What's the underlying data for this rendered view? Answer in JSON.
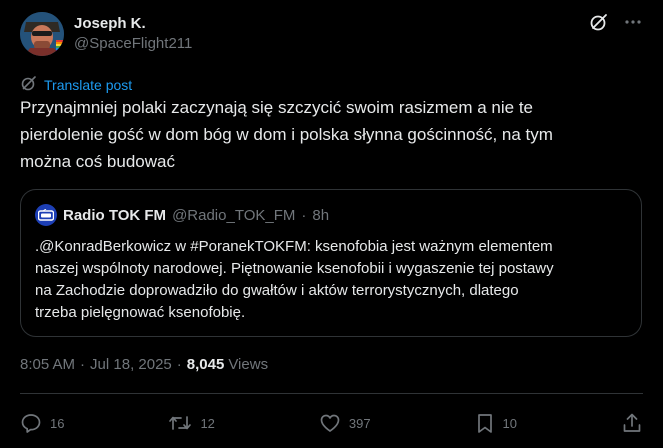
{
  "author": {
    "display_name": "Joseph K.",
    "handle": "@SpaceFlight211",
    "avatar_icon": "profile-avatar"
  },
  "header_actions": {
    "grok_icon": "grok-icon",
    "more_icon": "more-icon"
  },
  "translate": {
    "label": "Translate post",
    "icon": "translate-icon"
  },
  "post": {
    "lines": [
      "Przynajmniej polaki zaczynają się szczycić swoim rasizmem a nie te",
      "pierdolenie gość w dom bóg w dom i polska słynna gościnność, na tym",
      "można coś budować"
    ]
  },
  "quote": {
    "name": "Radio TOK FM",
    "handle": "@Radio_TOK_FM",
    "separator": "·",
    "time": "8h",
    "lines": [
      ".@KonradBerkowicz w #PoranekTOKFM: ksenofobia jest ważnym elementem",
      "naszej wspólnoty narodowej. Piętnowanie ksenofobii i wygaszenie tej postawy",
      "na Zachodzie doprowadziło do gwałtów i aktów terrorystycznych, dlatego",
      "trzeba pielęgnować ksenofobię."
    ]
  },
  "meta": {
    "time": "8:05 AM",
    "separator": "·",
    "date": "Jul 18, 2025",
    "views_count": "8,045",
    "views_label": "Views"
  },
  "actions": {
    "replies": "16",
    "reposts": "12",
    "likes": "397",
    "bookmarks": "10"
  },
  "colors": {
    "background": "#000000",
    "text": "#e7e9ea",
    "secondary": "#71767b",
    "accent": "#1d9bf0",
    "border": "#2f3336"
  }
}
